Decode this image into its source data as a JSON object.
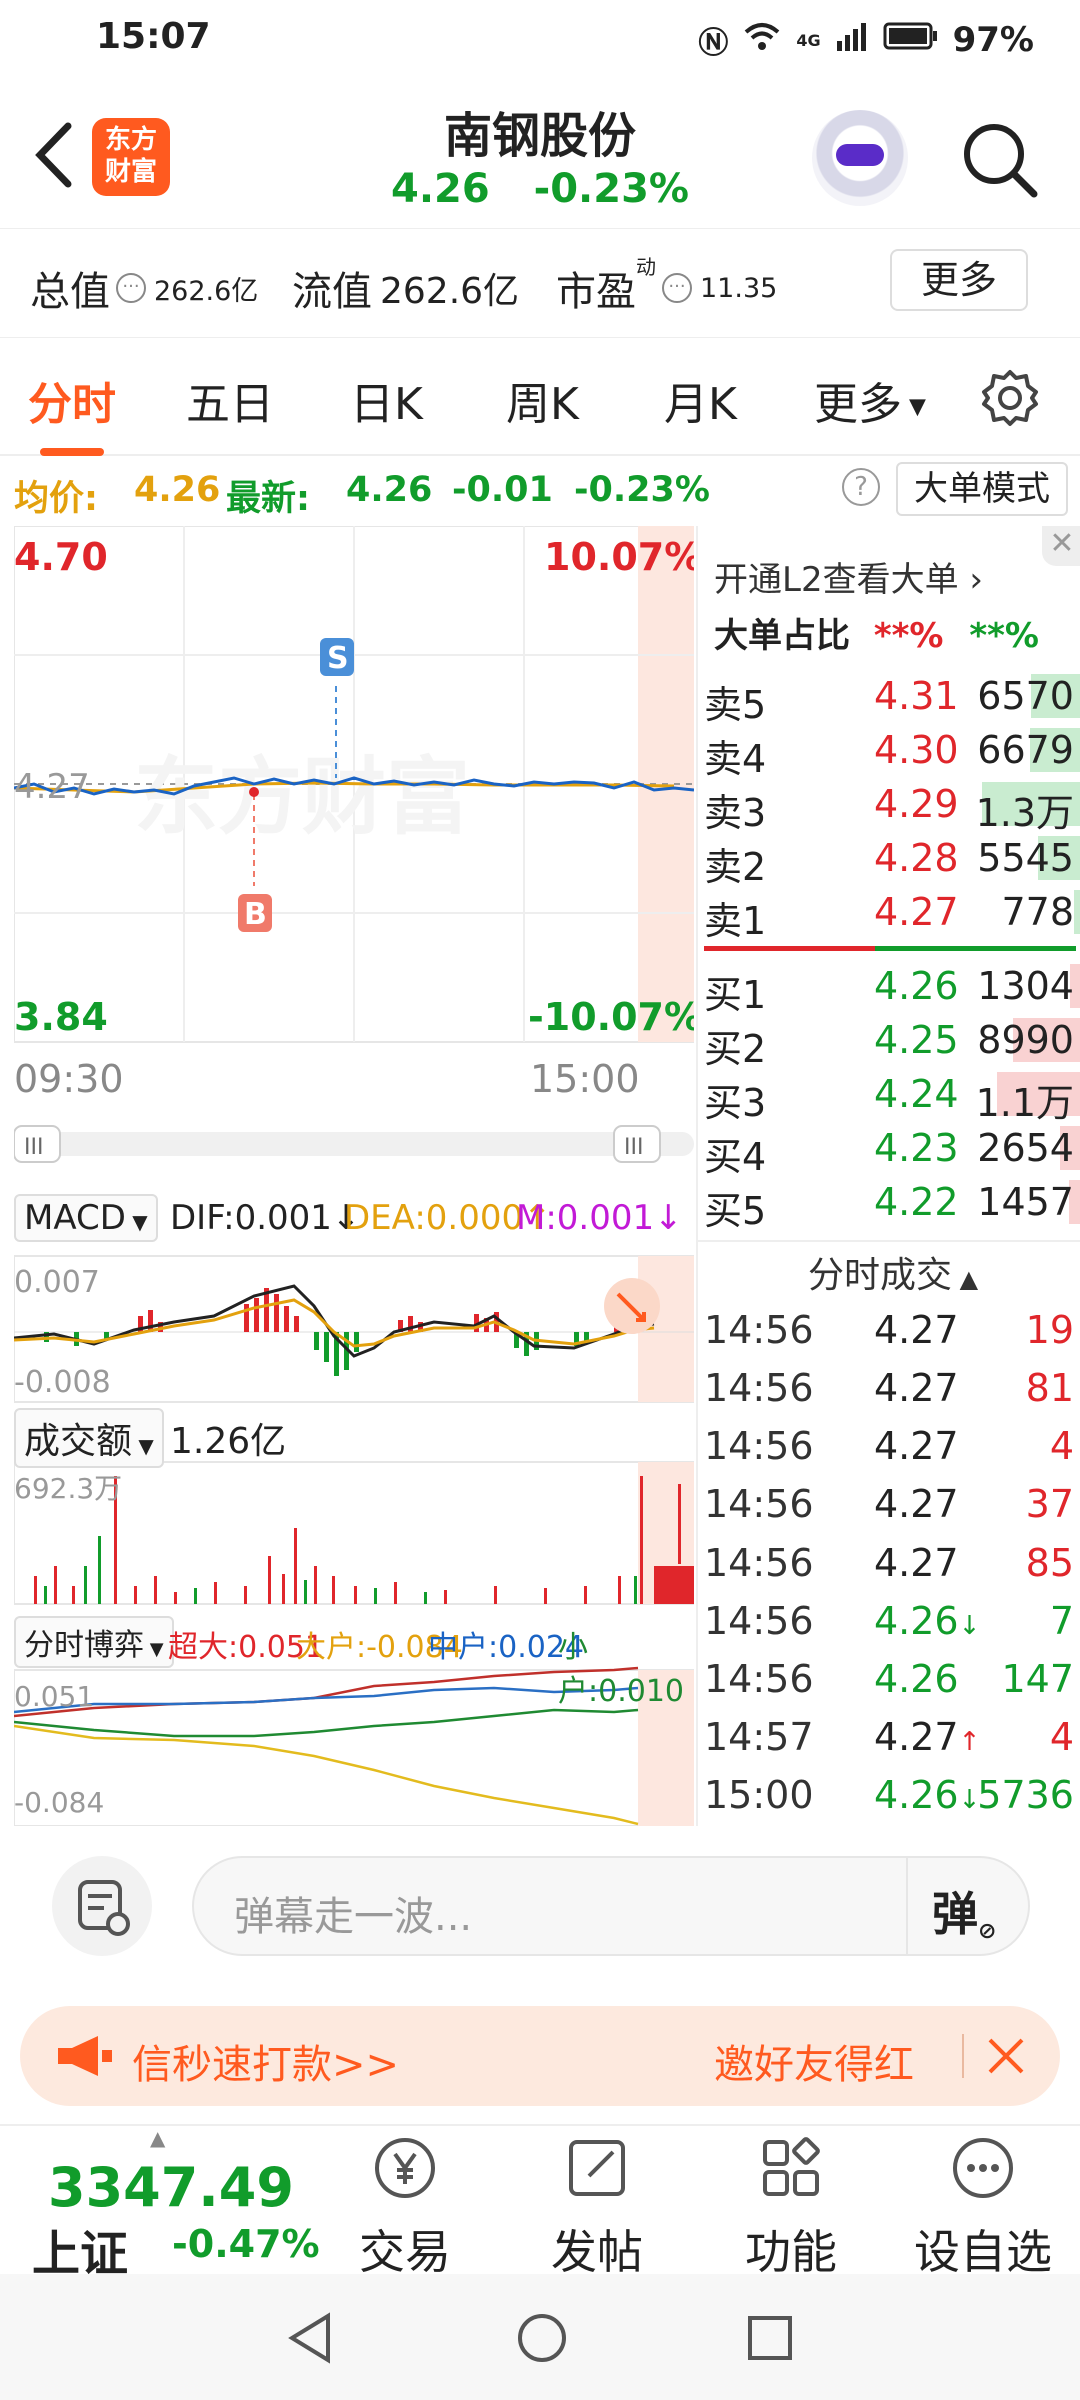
{
  "status": {
    "time": "15:07",
    "network": "4G",
    "battery": "97%"
  },
  "header": {
    "logo_line1": "东方",
    "logo_line2": "财富",
    "title": "南钢股份",
    "price": "4.26",
    "change_pct": "-0.23%"
  },
  "metrics": {
    "total_label": "总值",
    "total_value": "262.6亿",
    "float_label": "流值",
    "float_value": "262.6亿",
    "pe_label": "市盈",
    "pe_sup": "动",
    "pe_value": "11.35",
    "more_label": "更多"
  },
  "tabs": [
    "分时",
    "五日",
    "日K",
    "周K",
    "月K",
    "更多"
  ],
  "info": {
    "avg_label": "均价:",
    "avg_value": "4.26",
    "latest_label": "最新:",
    "latest_value": "4.26",
    "change": "-0.01",
    "change_pct": "-0.23%",
    "help": "?",
    "big_mode": "大单模式"
  },
  "chart": {
    "top_price": "4.70",
    "top_pct": "10.07%",
    "mid_price": "4.27",
    "bottom_price": "3.84",
    "bottom_pct": "-10.07%",
    "start_time": "09:30",
    "end_time": "15:00",
    "marker_sell": "S",
    "marker_buy": "B",
    "watermark": "东方财富"
  },
  "macd": {
    "label": "MACD",
    "dif": "DIF:0.001",
    "dea": "DEA:0.000",
    "m": "M:0.001",
    "top": "0.007",
    "bottom": "-0.008"
  },
  "volume": {
    "label": "成交额",
    "value": "1.26亿",
    "max": "692.3万"
  },
  "game": {
    "label": "分时博弈",
    "super": "超大:0.051",
    "large": "大户:-0.084",
    "mid": "中户:0.024",
    "small": "小户:0.010",
    "top": "0.051",
    "bottom": "-0.084"
  },
  "orderbook": {
    "l2_link": "开通L2查看大单",
    "ratio_label": "大单占比",
    "ratio_red": "**%",
    "ratio_green": "**%",
    "asks": [
      {
        "label": "卖5",
        "price": "4.31",
        "vol": "6570",
        "fill": 0.35
      },
      {
        "label": "卖4",
        "price": "4.30",
        "vol": "6679",
        "fill": 0.36
      },
      {
        "label": "卖3",
        "price": "4.29",
        "vol": "1.3万",
        "fill": 0.7
      },
      {
        "label": "卖2",
        "price": "4.28",
        "vol": "5545",
        "fill": 0.3
      },
      {
        "label": "卖1",
        "price": "4.27",
        "vol": "778",
        "fill": 0.04
      }
    ],
    "bids": [
      {
        "label": "买1",
        "price": "4.26",
        "vol": "1304",
        "fill": 0.07
      },
      {
        "label": "买2",
        "price": "4.25",
        "vol": "8990",
        "fill": 0.48
      },
      {
        "label": "买3",
        "price": "4.24",
        "vol": "1.1万",
        "fill": 0.59
      },
      {
        "label": "买4",
        "price": "4.23",
        "vol": "2654",
        "fill": 0.14
      },
      {
        "label": "买5",
        "price": "4.22",
        "vol": "1457",
        "fill": 0.08
      }
    ]
  },
  "trades": {
    "label": "分时成交",
    "rows": [
      {
        "time": "14:56",
        "price": "4.27",
        "vol": "19",
        "dir": "",
        "pc": "#222",
        "vc": "#e0262b"
      },
      {
        "time": "14:56",
        "price": "4.27",
        "vol": "81",
        "dir": "",
        "pc": "#222",
        "vc": "#e0262b"
      },
      {
        "time": "14:56",
        "price": "4.27",
        "vol": "4",
        "dir": "",
        "pc": "#222",
        "vc": "#e0262b"
      },
      {
        "time": "14:56",
        "price": "4.27",
        "vol": "37",
        "dir": "",
        "pc": "#222",
        "vc": "#e0262b"
      },
      {
        "time": "14:56",
        "price": "4.27",
        "vol": "85",
        "dir": "",
        "pc": "#222",
        "vc": "#e0262b"
      },
      {
        "time": "14:56",
        "price": "4.26",
        "vol": "7",
        "dir": "↓",
        "pc": "#119c2b",
        "vc": "#119c2b"
      },
      {
        "time": "14:56",
        "price": "4.26",
        "vol": "147",
        "dir": "",
        "pc": "#119c2b",
        "vc": "#119c2b"
      },
      {
        "time": "14:57",
        "price": "4.27",
        "vol": "4",
        "dir": "↑",
        "pc": "#222",
        "vc": "#e0262b"
      },
      {
        "time": "15:00",
        "price": "4.26",
        "vol": "5736",
        "dir": "↓",
        "pc": "#119c2b",
        "vc": "#119c2b"
      }
    ]
  },
  "chat": {
    "placeholder": "弹幕走一波...",
    "danmu_button": "弹"
  },
  "banner": {
    "left_text": "信秒速打款>>",
    "right_text": "邀好友得红"
  },
  "bottom": {
    "index_value": "3347.49",
    "index_name": "上证",
    "index_pct": "-0.47%",
    "nav": [
      "交易",
      "发帖",
      "功能",
      "设自选"
    ]
  }
}
